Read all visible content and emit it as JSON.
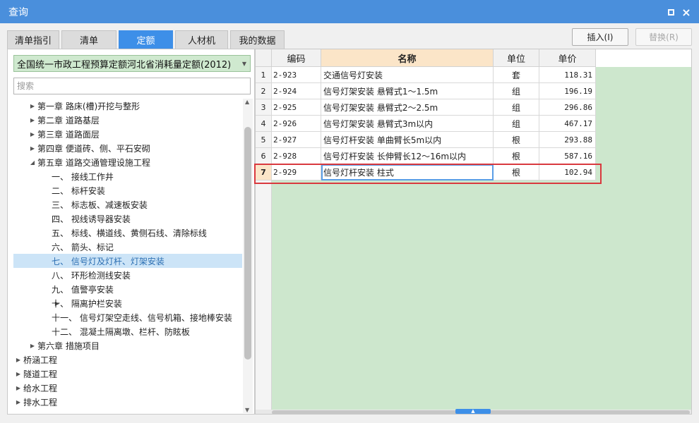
{
  "window": {
    "title": "查询"
  },
  "tabs": [
    {
      "label": "清单指引",
      "active": false
    },
    {
      "label": "清单",
      "active": false
    },
    {
      "label": "定额",
      "active": true
    },
    {
      "label": "人材机",
      "active": false
    },
    {
      "label": "我的数据",
      "active": false
    }
  ],
  "actions": {
    "insert_label": "插入(I)",
    "replace_label": "替换(R)"
  },
  "library": {
    "selected": "全国统一市政工程预算定额河北省消耗量定额(2012)"
  },
  "search": {
    "placeholder": "搜索"
  },
  "tree": [
    {
      "label": "第一章 路床(槽)开挖与整形",
      "level": 2,
      "expander": "collapsed"
    },
    {
      "label": "第二章 道路基层",
      "level": 2,
      "expander": "collapsed"
    },
    {
      "label": "第三章 道路面层",
      "level": 2,
      "expander": "collapsed"
    },
    {
      "label": "第四章 便道砖、侧、平石安砌",
      "level": 2,
      "expander": "collapsed"
    },
    {
      "label": "第五章 道路交通管理设施工程",
      "level": 2,
      "expander": "expanded"
    },
    {
      "label": "一、 接线工作井",
      "level": 3,
      "expander": "none"
    },
    {
      "label": "二、 标杆安装",
      "level": 3,
      "expander": "none"
    },
    {
      "label": "三、 标志板、减速板安装",
      "level": 3,
      "expander": "none"
    },
    {
      "label": "四、 视线诱导器安装",
      "level": 3,
      "expander": "none"
    },
    {
      "label": "五、 标线、横道线、黄侧石线、清除标线",
      "level": 3,
      "expander": "none"
    },
    {
      "label": "六、 箭头、标记",
      "level": 3,
      "expander": "none"
    },
    {
      "label": "七、 信号灯及灯杆、灯架安装",
      "level": 3,
      "expander": "none",
      "selected": true
    },
    {
      "label": "八、 环形检测线安装",
      "level": 3,
      "expander": "none"
    },
    {
      "label": "九、 值警亭安装",
      "level": 3,
      "expander": "none"
    },
    {
      "label": "十、 隔离护栏安装",
      "level": 3,
      "expander": "collapsed"
    },
    {
      "label": "十一、 信号灯架空走线、信号机箱、接地棒安装",
      "level": 3,
      "expander": "none"
    },
    {
      "label": "十二、 混凝土隔离墩、栏杆、防眩板",
      "level": 3,
      "expander": "none"
    },
    {
      "label": "第六章 措施项目",
      "level": 2,
      "expander": "collapsed"
    },
    {
      "label": "桥涵工程",
      "level": 1,
      "expander": "collapsed"
    },
    {
      "label": "隧道工程",
      "level": 1,
      "expander": "collapsed"
    },
    {
      "label": "给水工程",
      "level": 1,
      "expander": "collapsed"
    },
    {
      "label": "排水工程",
      "level": 1,
      "expander": "collapsed"
    }
  ],
  "grid": {
    "columns": {
      "code": "编码",
      "name": "名称",
      "unit": "单位",
      "price": "单价"
    },
    "rows": [
      {
        "num": "1",
        "code": "2-923",
        "name": "交通信号灯安装",
        "unit": "套",
        "price": "118.31"
      },
      {
        "num": "2",
        "code": "2-924",
        "name": "信号灯架安装 悬臂式1～1.5m",
        "unit": "组",
        "price": "196.19"
      },
      {
        "num": "3",
        "code": "2-925",
        "name": "信号灯架安装 悬臂式2～2.5m",
        "unit": "组",
        "price": "296.86"
      },
      {
        "num": "4",
        "code": "2-926",
        "name": "信号灯架安装 悬臂式3m以内",
        "unit": "组",
        "price": "467.17"
      },
      {
        "num": "5",
        "code": "2-927",
        "name": "信号灯杆安装 单曲臂长5m以内",
        "unit": "根",
        "price": "293.88"
      },
      {
        "num": "6",
        "code": "2-928",
        "name": "信号灯杆安装 长伸臂长12～16m以内",
        "unit": "根",
        "price": "587.16"
      },
      {
        "num": "7",
        "code": "2-929",
        "name": "信号灯杆安装 柱式",
        "unit": "根",
        "price": "102.94",
        "current": true
      }
    ]
  },
  "colors": {
    "accent": "#3d8fe8",
    "titlebar": "#4a8fdc",
    "grid_fill": "#cde7cd",
    "highlight_box": "#d9393e"
  }
}
